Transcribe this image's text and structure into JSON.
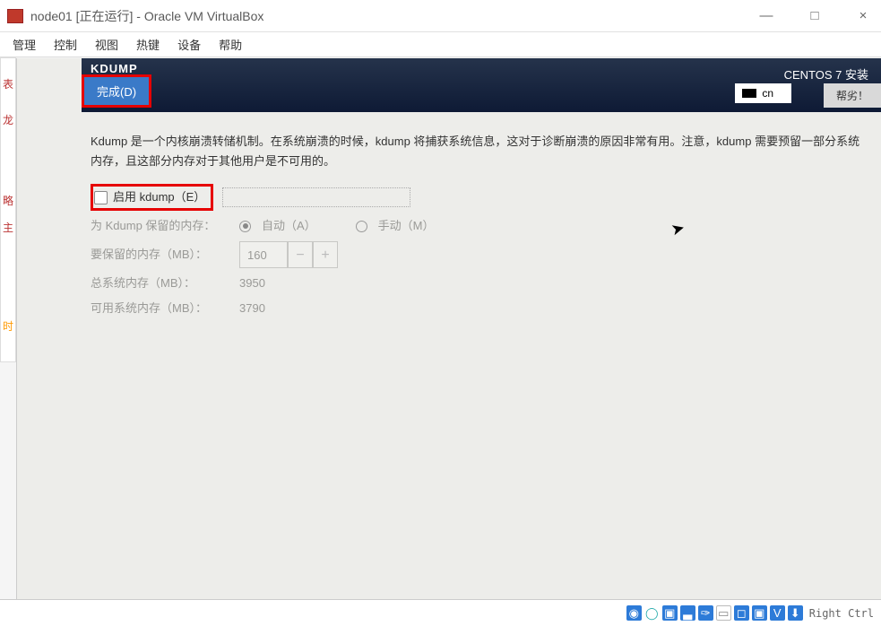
{
  "titlebar": {
    "title": "node01 [正在运行] - Oracle VM VirtualBox"
  },
  "menubar": {
    "items": [
      "管理",
      "控制",
      "视图",
      "热键",
      "设备",
      "帮助"
    ]
  },
  "header": {
    "title": "KDUMP",
    "done": "完成(D)",
    "product": "CENTOS 7 安装",
    "keyboard": "cn",
    "help": "帮劣！"
  },
  "content": {
    "description": "Kdump 是一个内核崩溃转储机制。在系统崩溃的时候，kdump 将捕获系统信息，这对于诊断崩溃的原因非常有用。注意，kdump 需要预留一部分系统内存，且这部分内存对于其他用户是不可用的。",
    "enable_label": "启用 kdump（E）",
    "reserve_label": "为 Kdump 保留的内存：",
    "auto_label": "自动（A）",
    "manual_label": "手动（M）",
    "to_reserve_label": "要保留的内存（MB）：",
    "to_reserve_value": "160",
    "total_label": "总系统内存（MB）：",
    "total_value": "3950",
    "avail_label": "可用系统内存（MB）：",
    "avail_value": "3790"
  },
  "statusbar": {
    "key": "Right Ctrl"
  }
}
